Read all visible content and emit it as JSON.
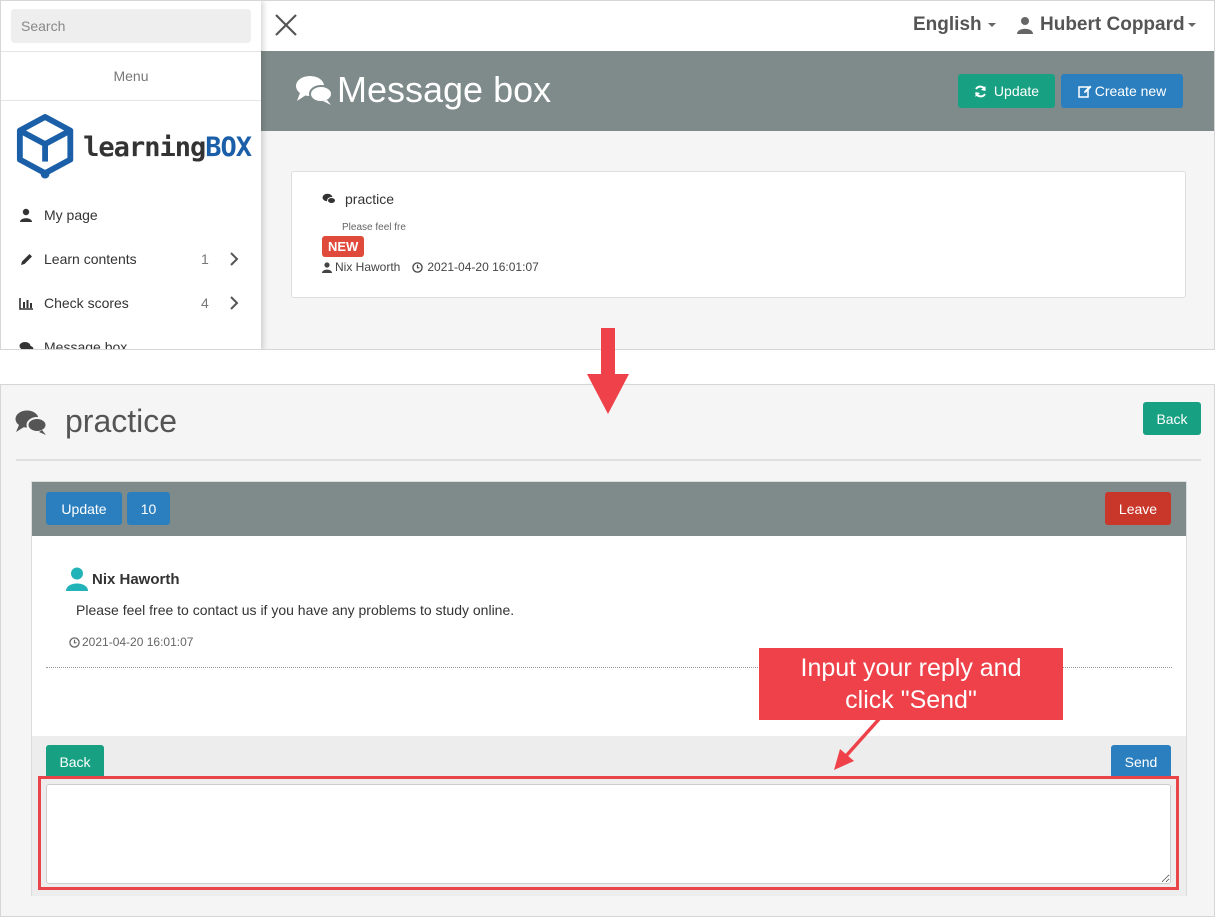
{
  "top": {
    "search_placeholder": "Search",
    "menu_label": "Menu",
    "logo": {
      "word1": "learning",
      "word2": "BOX",
      "accent": "#1a5fa8"
    },
    "sidebar": [
      {
        "label": "My page",
        "icon": "user-icon",
        "count": ""
      },
      {
        "label": "Learn contents",
        "icon": "pencil-icon",
        "count": "1"
      },
      {
        "label": "Check scores",
        "icon": "bar-chart-icon",
        "count": "4"
      },
      {
        "label": "Message box",
        "icon": "comments-icon",
        "count": ""
      }
    ],
    "language": "English",
    "user_name": "Hubert Coppard",
    "page_title": "Message box",
    "update_label": "Update",
    "create_label": "Create new",
    "message": {
      "title": "practice",
      "preview": "Please feel fre",
      "badge": "NEW",
      "author": "Nix Haworth",
      "timestamp": "2021-04-20 16:01:07"
    }
  },
  "bottom": {
    "thread_title": "practice",
    "back_label": "Back",
    "update_label": "Update",
    "count": "10",
    "leave_label": "Leave",
    "post": {
      "author": "Nix Haworth",
      "body": "Please feel free to contact us if you have any problems to study online.",
      "timestamp": "2021-04-20 16:01:07"
    },
    "reply": {
      "back_label": "Back",
      "send_label": "Send",
      "value": ""
    }
  },
  "annotation": {
    "callout_line1": "Input your reply and",
    "callout_line2": "click \"Send\""
  },
  "colors": {
    "teal": "#17a081",
    "blue": "#2b7fbe",
    "red": "#c9362a",
    "header_gray": "#7f8b8a",
    "callout_red": "#ef4149"
  }
}
